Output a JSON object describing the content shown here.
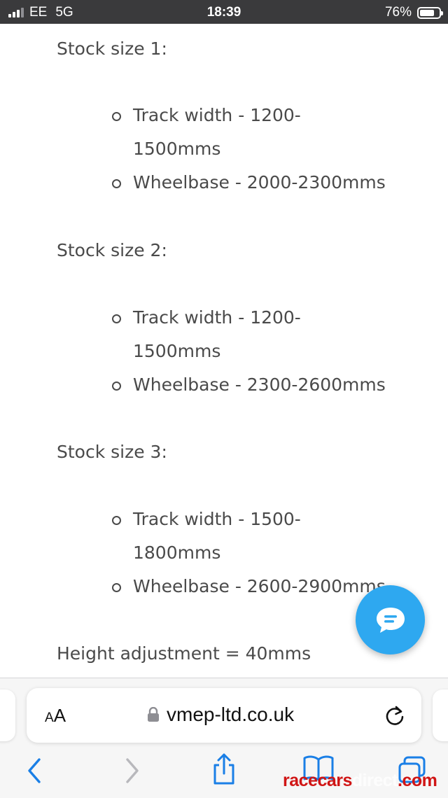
{
  "status_bar": {
    "carrier": "EE",
    "network": "5G",
    "time": "18:39",
    "battery_percent": "76%",
    "battery_level": 0.76,
    "signal_bars": 3,
    "signal_bars_total": 4
  },
  "content": {
    "sections": [
      {
        "heading": "Stock size 1:",
        "items": [
          {
            "line1": "Track width - 1200-",
            "line2": "1500mms"
          },
          {
            "line1": "Wheelbase - 2000-2300mms"
          }
        ]
      },
      {
        "heading": "Stock size 2:",
        "items": [
          {
            "line1": "Track width - 1200-",
            "line2": "1500mms"
          },
          {
            "line1": "Wheelbase - 2300-2600mms"
          }
        ]
      },
      {
        "heading": "Stock size 3:",
        "items": [
          {
            "line1": "Track width - 1500-",
            "line2": "1800mms"
          },
          {
            "line1": "Wheelbase - 2600-2900mms"
          }
        ]
      }
    ],
    "footer_text": "Height adjustment = 40mms"
  },
  "chat_button": {
    "icon": "chat-bubble-icon",
    "color": "#2ea8f0"
  },
  "browser": {
    "aa_label_small": "A",
    "aa_label_big": "A",
    "url": "vmep-ltd.co.uk",
    "lock_icon": "lock-icon",
    "reload_icon": "reload-icon",
    "nav_icons": [
      "back-icon",
      "forward-icon",
      "share-icon",
      "bookmarks-icon",
      "tabs-icon"
    ],
    "accent_color": "#1a7fe6"
  },
  "watermark": {
    "part1": "racecars",
    "part2": "direct",
    "part3": ".com"
  }
}
